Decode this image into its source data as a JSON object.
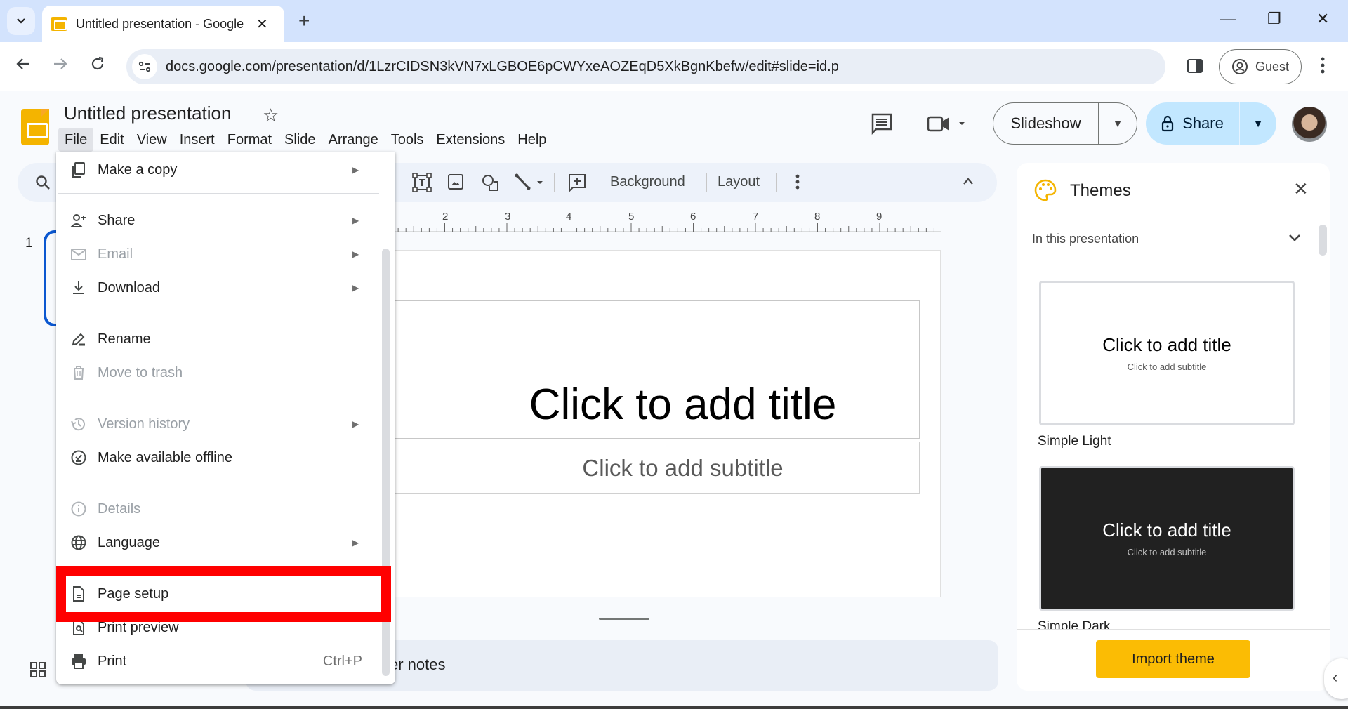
{
  "browser": {
    "tab_title": "Untitled presentation - Google Slides",
    "url": "docs.google.com/presentation/d/1LzrCIDSN3kVN7xLGBOE6pCWYxeAOZEqD5XkBgnKbefw/edit#slide=id.p",
    "profile_label": "Guest",
    "new_tab": "+",
    "close_tab": "✕",
    "minimize": "—",
    "restore": "❐",
    "close_window": "✕"
  },
  "app": {
    "doc_title": "Untitled presentation",
    "menus": [
      "File",
      "Edit",
      "View",
      "Insert",
      "Format",
      "Slide",
      "Arrange",
      "Tools",
      "Extensions",
      "Help"
    ],
    "active_menu": "File",
    "slideshow_label": "Slideshow",
    "share_label": "Share"
  },
  "toolbar": {
    "background_label": "Background",
    "layout_label": "Layout"
  },
  "ruler": {
    "numbers": [
      "2",
      "3",
      "4",
      "5",
      "6",
      "7",
      "8",
      "9"
    ]
  },
  "filmstrip": {
    "slide_number": "1"
  },
  "slide": {
    "title_placeholder": "Click to add title",
    "subtitle_placeholder": "Click to add subtitle"
  },
  "notes": {
    "visible_text": "er notes"
  },
  "file_menu": {
    "items": [
      {
        "label": "Make a copy",
        "icon": "copy-icon",
        "submenu": true,
        "disabled": false
      },
      {
        "label": "Share",
        "icon": "person-add-icon",
        "submenu": true,
        "disabled": false
      },
      {
        "label": "Email",
        "icon": "mail-icon",
        "submenu": true,
        "disabled": true
      },
      {
        "label": "Download",
        "icon": "download-icon",
        "submenu": true,
        "disabled": false
      },
      {
        "label": "Rename",
        "icon": "rename-icon",
        "submenu": false,
        "disabled": false
      },
      {
        "label": "Move to trash",
        "icon": "trash-icon",
        "submenu": false,
        "disabled": true
      },
      {
        "label": "Version history",
        "icon": "history-icon",
        "submenu": true,
        "disabled": true
      },
      {
        "label": "Make available offline",
        "icon": "offline-icon",
        "submenu": false,
        "disabled": false
      },
      {
        "label": "Details",
        "icon": "info-icon",
        "submenu": false,
        "disabled": true
      },
      {
        "label": "Language",
        "icon": "globe-icon",
        "submenu": true,
        "disabled": false
      },
      {
        "label": "Page setup",
        "icon": "page-icon",
        "submenu": false,
        "disabled": false,
        "highlighted": true
      },
      {
        "label": "Print preview",
        "icon": "print-preview-icon",
        "submenu": false,
        "disabled": false
      },
      {
        "label": "Print",
        "icon": "print-icon",
        "submenu": false,
        "disabled": false,
        "shortcut": "Ctrl+P"
      }
    ],
    "submenu_arrow": "▶"
  },
  "themes": {
    "title": "Themes",
    "source_label": "In this presentation",
    "cards": [
      {
        "name": "Simple Light",
        "title": "Click to add title",
        "subtitle": "Click to add subtitle",
        "style": "light"
      },
      {
        "name": "Simple Dark",
        "title": "Click to add title",
        "subtitle": "Click to add subtitle",
        "style": "dark"
      }
    ],
    "import_label": "Import theme"
  },
  "colors": {
    "accent_blue": "#0b57d0",
    "share_bg": "#c2e7ff",
    "import_yellow": "#fbbc04",
    "highlight_red": "#ff0000",
    "slides_yellow": "#f4b400"
  }
}
